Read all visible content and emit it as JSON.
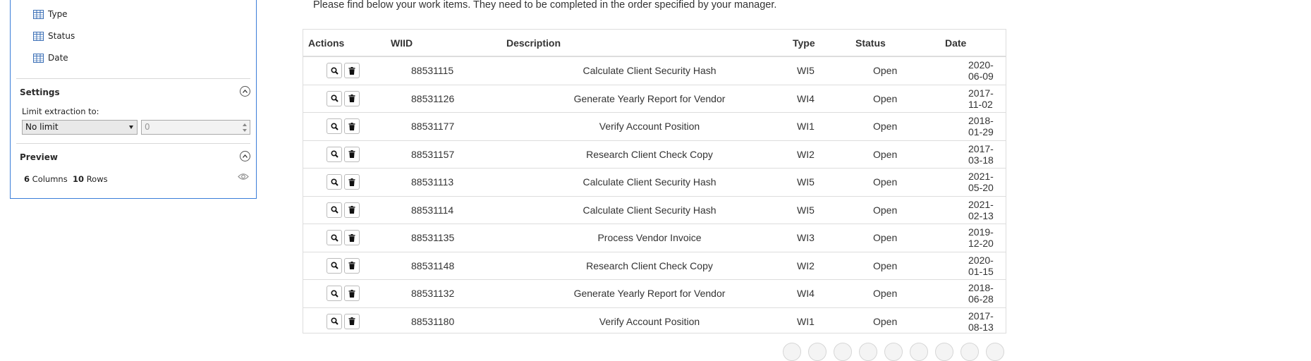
{
  "panel": {
    "fields": [
      "Type",
      "Status",
      "Date"
    ],
    "settings": {
      "title": "Settings",
      "limit_label": "Limit extraction to:",
      "limit_option": "No limit",
      "limit_value_placeholder": "0"
    },
    "preview": {
      "title": "Preview",
      "columns_count": "6",
      "columns_label": "Columns",
      "rows_count": "10",
      "rows_label": "Rows"
    },
    "icons": {
      "field": "table-column-icon",
      "collapse": "chevron-up-icon",
      "preview": "eye-icon"
    }
  },
  "main": {
    "intro": "Please find below your work items. They need to be completed in the order specified by your manager.",
    "table": {
      "headers": [
        "Actions",
        "WIID",
        "Description",
        "Type",
        "Status",
        "Date"
      ],
      "rows": [
        {
          "wiid": "88531115",
          "description": "Calculate Client Security Hash",
          "type": "WI5",
          "status": "Open",
          "date": "2020-06-09"
        },
        {
          "wiid": "88531126",
          "description": "Generate Yearly Report for Vendor",
          "type": "WI4",
          "status": "Open",
          "date": "2017-11-02"
        },
        {
          "wiid": "88531177",
          "description": "Verify Account Position",
          "type": "WI1",
          "status": "Open",
          "date": "2018-01-29"
        },
        {
          "wiid": "88531157",
          "description": "Research Client Check Copy",
          "type": "WI2",
          "status": "Open",
          "date": "2017-03-18"
        },
        {
          "wiid": "88531113",
          "description": "Calculate Client Security Hash",
          "type": "WI5",
          "status": "Open",
          "date": "2021-05-20"
        },
        {
          "wiid": "88531114",
          "description": "Calculate Client Security Hash",
          "type": "WI5",
          "status": "Open",
          "date": "2021-02-13"
        },
        {
          "wiid": "88531135",
          "description": "Process Vendor Invoice",
          "type": "WI3",
          "status": "Open",
          "date": "2019-12-20"
        },
        {
          "wiid": "88531148",
          "description": "Research Client Check Copy",
          "type": "WI2",
          "status": "Open",
          "date": "2020-01-15"
        },
        {
          "wiid": "88531132",
          "description": "Generate Yearly Report for Vendor",
          "type": "WI4",
          "status": "Open",
          "date": "2018-06-28"
        },
        {
          "wiid": "88531180",
          "description": "Verify Account Position",
          "type": "WI1",
          "status": "Open",
          "date": "2017-08-13"
        }
      ],
      "action_icons": [
        "search-icon",
        "trash-icon"
      ]
    },
    "pagination": [
      "",
      "",
      "",
      "",
      "",
      "",
      "",
      "",
      ""
    ]
  }
}
